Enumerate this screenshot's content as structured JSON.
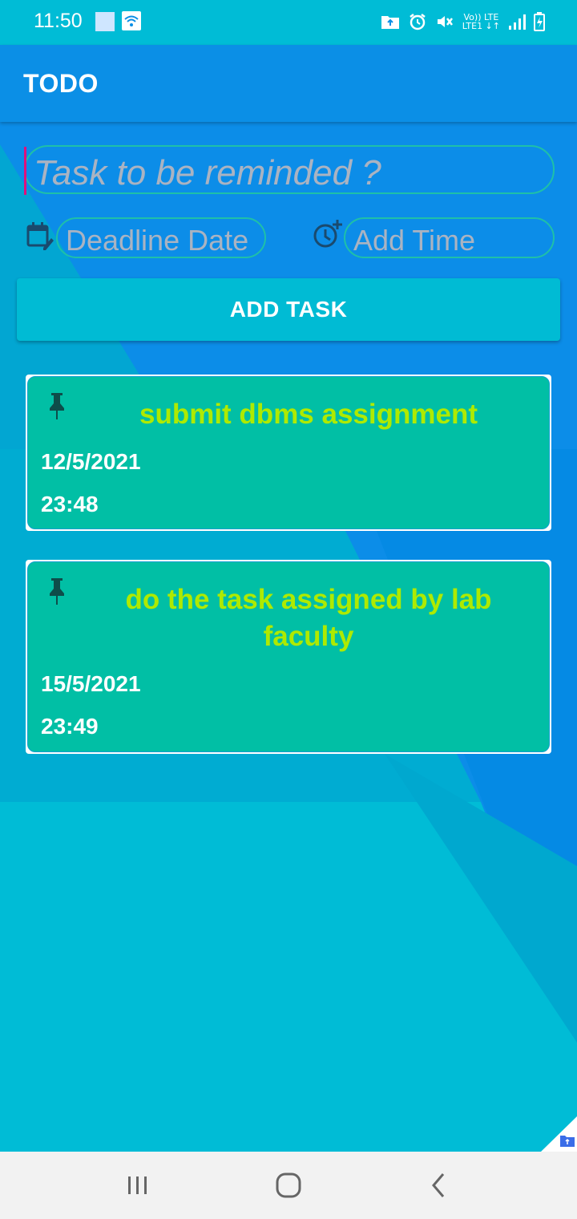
{
  "status_bar": {
    "time": "11:50",
    "lte_top": "Vo)) LTE",
    "lte_bottom": "LTE1 ↓↑"
  },
  "app_bar": {
    "title": "TODO"
  },
  "form": {
    "task_placeholder": "Task to be reminded ?",
    "date_placeholder": "Deadline Date",
    "time_placeholder": "Add Time",
    "add_button_label": "ADD TASK"
  },
  "tasks": [
    {
      "title": "submit dbms assignment",
      "date": "12/5/2021",
      "time": "23:48"
    },
    {
      "title": "do the task assigned by lab faculty",
      "date": "15/5/2021",
      "time": "23:49"
    }
  ],
  "colors": {
    "app_bar": "#0B8FE6",
    "card": "#01BFA5",
    "task_title": "#AEEA00",
    "button": "#00BBD4",
    "outline": "#1FC0A8"
  },
  "icons": {
    "calendar": "calendar-edit-icon",
    "clock": "clock-add-icon",
    "pin": "pin-icon",
    "nav": [
      "recents-icon",
      "home-icon",
      "back-icon"
    ]
  }
}
